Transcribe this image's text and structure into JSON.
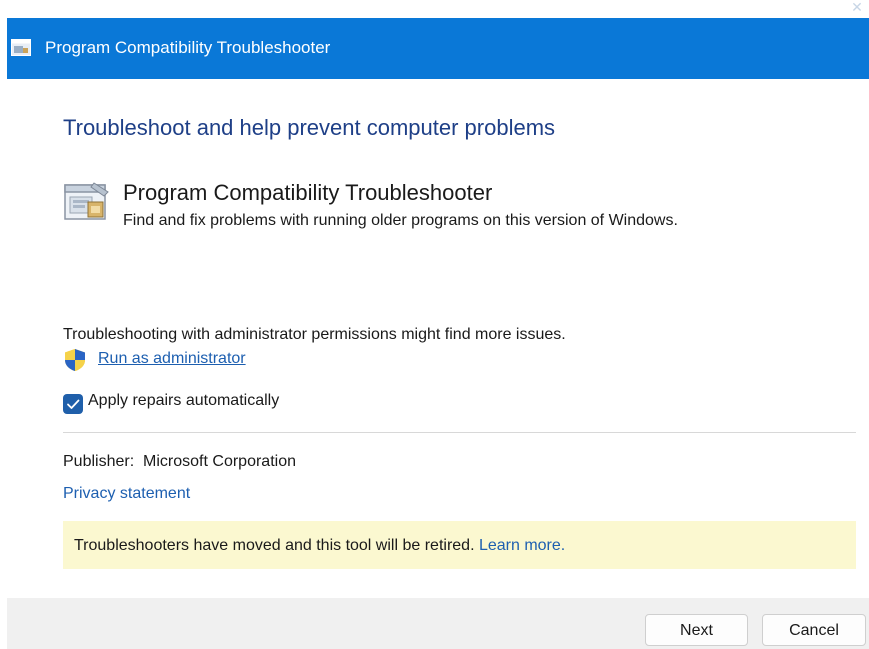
{
  "window": {
    "title": "Program Compatibility Troubleshooter",
    "title_icon": "troubleshooter-icon",
    "close_icon": "close-icon",
    "accent_color": "#0a78d7"
  },
  "main": {
    "heading": "Troubleshoot and help prevent computer problems",
    "tool": {
      "icon": "program-compatibility-icon",
      "title": "Program Compatibility Troubleshooter",
      "description": "Find and fix problems with running older programs on this version of Windows."
    },
    "admin": {
      "note": "Troubleshooting with administrator permissions might find more issues.",
      "shield_icon": "uac-shield-icon",
      "link_label": "Run as administrator"
    },
    "apply_repairs": {
      "label": "Apply repairs automatically",
      "checked": true
    },
    "publisher": {
      "label": "Publisher:",
      "value": "Microsoft Corporation"
    },
    "privacy_link": "Privacy statement",
    "notice": {
      "text": "Troubleshooters have moved and this tool will be retired. ",
      "link_label": "Learn more.",
      "background": "#fbf8d0"
    }
  },
  "footer": {
    "next_label": "Next",
    "cancel_label": "Cancel"
  }
}
